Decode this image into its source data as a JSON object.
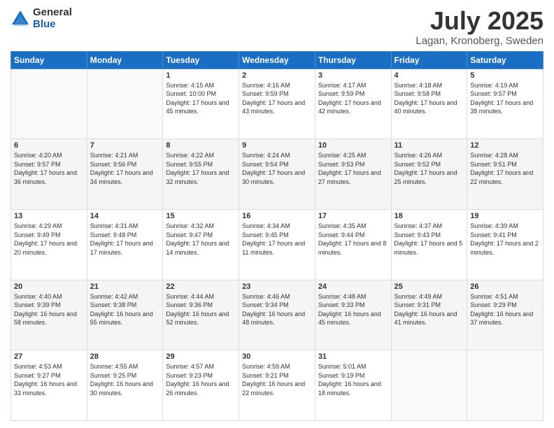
{
  "logo": {
    "general": "General",
    "blue": "Blue"
  },
  "title": {
    "month": "July 2025",
    "location": "Lagan, Kronoberg, Sweden"
  },
  "weekdays": [
    "Sunday",
    "Monday",
    "Tuesday",
    "Wednesday",
    "Thursday",
    "Friday",
    "Saturday"
  ],
  "weeks": [
    [
      {
        "day": "",
        "info": ""
      },
      {
        "day": "",
        "info": ""
      },
      {
        "day": "1",
        "info": "Sunrise: 4:15 AM\nSunset: 10:00 PM\nDaylight: 17 hours\nand 45 minutes."
      },
      {
        "day": "2",
        "info": "Sunrise: 4:16 AM\nSunset: 9:59 PM\nDaylight: 17 hours\nand 43 minutes."
      },
      {
        "day": "3",
        "info": "Sunrise: 4:17 AM\nSunset: 9:59 PM\nDaylight: 17 hours\nand 42 minutes."
      },
      {
        "day": "4",
        "info": "Sunrise: 4:18 AM\nSunset: 9:58 PM\nDaylight: 17 hours\nand 40 minutes."
      },
      {
        "day": "5",
        "info": "Sunrise: 4:19 AM\nSunset: 9:57 PM\nDaylight: 17 hours\nand 38 minutes."
      }
    ],
    [
      {
        "day": "6",
        "info": "Sunrise: 4:20 AM\nSunset: 9:57 PM\nDaylight: 17 hours\nand 36 minutes."
      },
      {
        "day": "7",
        "info": "Sunrise: 4:21 AM\nSunset: 9:56 PM\nDaylight: 17 hours\nand 34 minutes."
      },
      {
        "day": "8",
        "info": "Sunrise: 4:22 AM\nSunset: 9:55 PM\nDaylight: 17 hours\nand 32 minutes."
      },
      {
        "day": "9",
        "info": "Sunrise: 4:24 AM\nSunset: 9:54 PM\nDaylight: 17 hours\nand 30 minutes."
      },
      {
        "day": "10",
        "info": "Sunrise: 4:25 AM\nSunset: 9:53 PM\nDaylight: 17 hours\nand 27 minutes."
      },
      {
        "day": "11",
        "info": "Sunrise: 4:26 AM\nSunset: 9:52 PM\nDaylight: 17 hours\nand 25 minutes."
      },
      {
        "day": "12",
        "info": "Sunrise: 4:28 AM\nSunset: 9:51 PM\nDaylight: 17 hours\nand 22 minutes."
      }
    ],
    [
      {
        "day": "13",
        "info": "Sunrise: 4:29 AM\nSunset: 9:49 PM\nDaylight: 17 hours\nand 20 minutes."
      },
      {
        "day": "14",
        "info": "Sunrise: 4:31 AM\nSunset: 9:48 PM\nDaylight: 17 hours\nand 17 minutes."
      },
      {
        "day": "15",
        "info": "Sunrise: 4:32 AM\nSunset: 9:47 PM\nDaylight: 17 hours\nand 14 minutes."
      },
      {
        "day": "16",
        "info": "Sunrise: 4:34 AM\nSunset: 9:45 PM\nDaylight: 17 hours\nand 11 minutes."
      },
      {
        "day": "17",
        "info": "Sunrise: 4:35 AM\nSunset: 9:44 PM\nDaylight: 17 hours\nand 8 minutes."
      },
      {
        "day": "18",
        "info": "Sunrise: 4:37 AM\nSunset: 9:43 PM\nDaylight: 17 hours\nand 5 minutes."
      },
      {
        "day": "19",
        "info": "Sunrise: 4:39 AM\nSunset: 9:41 PM\nDaylight: 17 hours\nand 2 minutes."
      }
    ],
    [
      {
        "day": "20",
        "info": "Sunrise: 4:40 AM\nSunset: 9:39 PM\nDaylight: 16 hours\nand 58 minutes."
      },
      {
        "day": "21",
        "info": "Sunrise: 4:42 AM\nSunset: 9:38 PM\nDaylight: 16 hours\nand 55 minutes."
      },
      {
        "day": "22",
        "info": "Sunrise: 4:44 AM\nSunset: 9:36 PM\nDaylight: 16 hours\nand 52 minutes."
      },
      {
        "day": "23",
        "info": "Sunrise: 4:46 AM\nSunset: 9:34 PM\nDaylight: 16 hours\nand 48 minutes."
      },
      {
        "day": "24",
        "info": "Sunrise: 4:48 AM\nSunset: 9:33 PM\nDaylight: 16 hours\nand 45 minutes."
      },
      {
        "day": "25",
        "info": "Sunrise: 4:49 AM\nSunset: 9:31 PM\nDaylight: 16 hours\nand 41 minutes."
      },
      {
        "day": "26",
        "info": "Sunrise: 4:51 AM\nSunset: 9:29 PM\nDaylight: 16 hours\nand 37 minutes."
      }
    ],
    [
      {
        "day": "27",
        "info": "Sunrise: 4:53 AM\nSunset: 9:27 PM\nDaylight: 16 hours\nand 33 minutes."
      },
      {
        "day": "28",
        "info": "Sunrise: 4:55 AM\nSunset: 9:25 PM\nDaylight: 16 hours\nand 30 minutes."
      },
      {
        "day": "29",
        "info": "Sunrise: 4:57 AM\nSunset: 9:23 PM\nDaylight: 16 hours\nand 26 minutes."
      },
      {
        "day": "30",
        "info": "Sunrise: 4:59 AM\nSunset: 9:21 PM\nDaylight: 16 hours\nand 22 minutes."
      },
      {
        "day": "31",
        "info": "Sunrise: 5:01 AM\nSunset: 9:19 PM\nDaylight: 16 hours\nand 18 minutes."
      },
      {
        "day": "",
        "info": ""
      },
      {
        "day": "",
        "info": ""
      }
    ]
  ]
}
